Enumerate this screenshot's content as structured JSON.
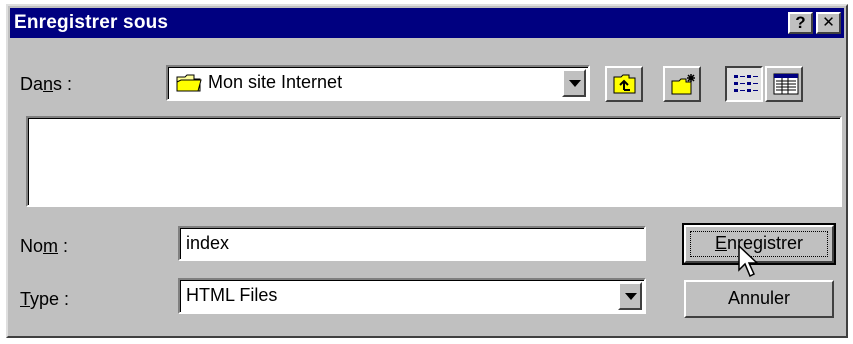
{
  "window": {
    "title": "Enregistrer sous",
    "help_label": "?",
    "close_label": "✕"
  },
  "location": {
    "label_pre": "Da",
    "label_underlined": "n",
    "label_post": "s :",
    "value": "Mon site Internet"
  },
  "filename": {
    "label_pre": "No",
    "label_underlined": "m",
    "label_post": " :",
    "value": "index"
  },
  "filetype": {
    "label_underlined": "T",
    "label_post": "ype :",
    "value": "HTML Files"
  },
  "buttons": {
    "save_underlined": "E",
    "save_rest": "nregistrer",
    "cancel": "Annuler"
  },
  "icons": [
    "folder-icon",
    "up-one-level-icon",
    "new-folder-icon",
    "list-view-icon",
    "details-view-icon",
    "mouse-pointer-icon"
  ],
  "colors": {
    "titlebar": "#000080",
    "face": "#c0c0c0"
  }
}
